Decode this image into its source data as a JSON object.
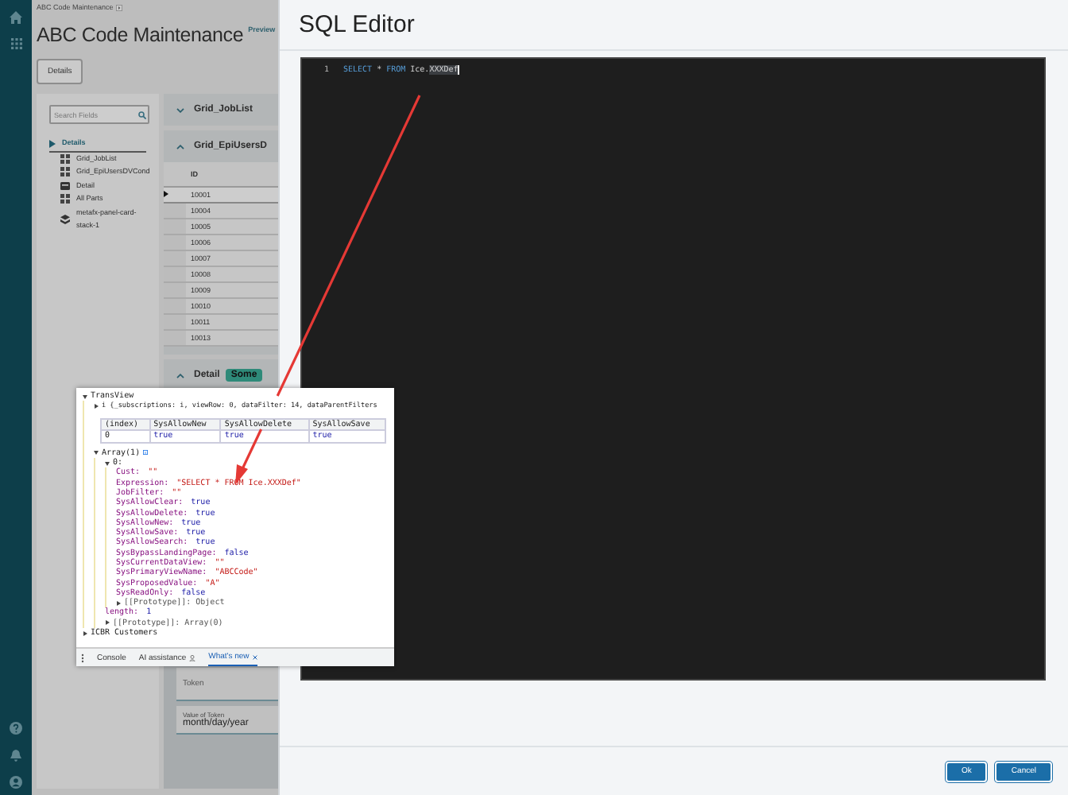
{
  "app": {
    "breadcrumb": "ABC Code Maintenance",
    "title": "ABC Code Maintenance",
    "preview": "Preview",
    "tabs": [
      {
        "label": "Details",
        "selected": true
      }
    ],
    "search": {
      "placeholder": "Search Fields"
    },
    "tree": [
      {
        "label": "Details",
        "kind": "group",
        "expanded": true,
        "selected": true,
        "children": [
          {
            "label": "Grid_JobList",
            "kind": "grid",
            "selected": false
          },
          {
            "label": "Grid_EpiUsersDVCond",
            "kind": "grid",
            "selected": false
          },
          {
            "label": "Detail",
            "kind": "card",
            "selected": false
          },
          {
            "label": "All Parts",
            "kind": "grid",
            "selected": false
          },
          {
            "label": "metafx-panel-card-stack-1",
            "kind": "stack",
            "selected": false
          }
        ]
      }
    ],
    "panels": [
      {
        "title": "Grid_JobList",
        "expanded": false
      },
      {
        "title": "Grid_EpiUsersD",
        "expanded": true,
        "table": {
          "columns": [
            "ID"
          ],
          "rows": [
            {
              "cells": [
                "10001"
              ],
              "selected": true
            },
            {
              "cells": [
                "10004"
              ],
              "selected": false
            },
            {
              "cells": [
                "10005"
              ],
              "selected": false
            },
            {
              "cells": [
                "10006"
              ],
              "selected": false
            },
            {
              "cells": [
                "10007"
              ],
              "selected": false
            },
            {
              "cells": [
                "10008"
              ],
              "selected": false
            },
            {
              "cells": [
                "10009"
              ],
              "selected": false
            },
            {
              "cells": [
                "10010"
              ],
              "selected": false
            },
            {
              "cells": [
                "10011"
              ],
              "selected": false
            },
            {
              "cells": [
                "10013"
              ],
              "selected": false
            }
          ]
        }
      },
      {
        "title": "Detail",
        "badge": "Some",
        "expanded": true,
        "fields": [
          {
            "label": "Token"
          },
          {
            "label": "Value of Token",
            "value": "month/day/year"
          }
        ]
      }
    ]
  },
  "devtools": {
    "tree": [
      {
        "kind": "node",
        "label": "TransView",
        "expanded": true,
        "children": [
          {
            "kind": "node",
            "label": "i {_subscriptions: i, viewRow: 0, dataFilter: 14, dataParentFilters",
            "expanded": false
          },
          {
            "kind": "table",
            "columns": [
              "(index)",
              "SysAllowNew",
              "SysAllowDelete",
              "SysAllowSave"
            ],
            "rows": [
              [
                "0",
                "true",
                "true",
                "true"
              ]
            ]
          },
          {
            "kind": "node",
            "label": "Array(1)",
            "info": true,
            "expanded": true,
            "children": [
              {
                "kind": "node",
                "label": "0:",
                "expanded": true,
                "children": [
                  {
                    "kind": "string",
                    "key": "Cust:",
                    "value": "\"\""
                  },
                  {
                    "kind": "string",
                    "key": "Expression:",
                    "value": "\"SELECT * FROM Ice.XXXDef\""
                  },
                  {
                    "kind": "string",
                    "key": "JobFilter:",
                    "value": "\"\""
                  },
                  {
                    "kind": "boolean",
                    "key": "SysAllowClear:",
                    "value": "true"
                  },
                  {
                    "kind": "boolean",
                    "key": "SysAllowDelete:",
                    "value": "true"
                  },
                  {
                    "kind": "boolean",
                    "key": "SysAllowNew:",
                    "value": "true"
                  },
                  {
                    "kind": "boolean",
                    "key": "SysAllowSave:",
                    "value": "true"
                  },
                  {
                    "kind": "boolean",
                    "key": "SysAllowSearch:",
                    "value": "true"
                  },
                  {
                    "kind": "boolean",
                    "key": "SysBypassLandingPage:",
                    "value": "false"
                  },
                  {
                    "kind": "string",
                    "key": "SysCurrentDataView:",
                    "value": "\"\""
                  },
                  {
                    "kind": "string",
                    "key": "SysPrimaryViewName:",
                    "value": "\"ABCCode\""
                  },
                  {
                    "kind": "string",
                    "key": "SysProposedValue:",
                    "value": "\"A\""
                  },
                  {
                    "kind": "boolean",
                    "key": "SysReadOnly:",
                    "value": "false"
                  },
                  {
                    "kind": "node",
                    "label": "[[Prototype]]: Object",
                    "expanded": false
                  }
                ]
              },
              {
                "kind": "number",
                "key": "length:",
                "value": "1"
              },
              {
                "kind": "node",
                "label": "[[Prototype]]: Array(0)",
                "expanded": false
              }
            ]
          }
        ]
      },
      {
        "kind": "node",
        "label": "ICBR Customers",
        "expanded": false
      }
    ],
    "tabs": [
      {
        "label": "Console",
        "selected": false,
        "kind": "plain",
        "closable": false
      },
      {
        "label": "AI assistance",
        "selected": false,
        "kind": "assistant",
        "closable": false
      },
      {
        "label": "What's new",
        "selected": true,
        "kind": "plain",
        "closable": true
      }
    ]
  },
  "dialog": {
    "title": "SQL Editor",
    "editor": {
      "lines": [
        {
          "number": "1",
          "tokens": [
            {
              "text": "SELECT",
              "kind": "keyword"
            },
            {
              "text": " * ",
              "kind": "plain"
            },
            {
              "text": "FROM",
              "kind": "keyword"
            },
            {
              "text": " Ice.",
              "kind": "plain"
            },
            {
              "text": "XXXDef",
              "kind": "selected"
            }
          ]
        }
      ]
    },
    "buttons": [
      {
        "label": "Ok"
      },
      {
        "label": "Cancel"
      }
    ]
  }
}
